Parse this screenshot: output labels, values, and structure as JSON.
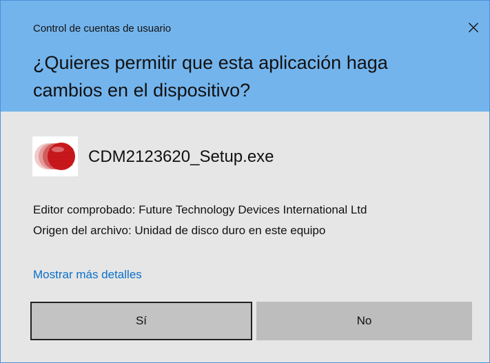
{
  "dialog": {
    "title": "Control de cuentas de usuario",
    "question": "¿Quieres permitir que esta aplicación haga cambios en el dispositivo?",
    "close_icon": "close-icon"
  },
  "app": {
    "icon": "ftdi-app-icon",
    "name": "CDM2123620_Setup.exe",
    "publisher": "Editor comprobado: Future Technology Devices International Ltd",
    "origin": "Origen del archivo: Unidad de disco duro en este equipo"
  },
  "details_link": "Mostrar más detalles",
  "buttons": {
    "yes": "Sí",
    "no": "No"
  },
  "colors": {
    "header": "#74b4ec",
    "body": "#e6e6e6",
    "link": "#0a6fc8",
    "button": "#bdbdbd"
  }
}
